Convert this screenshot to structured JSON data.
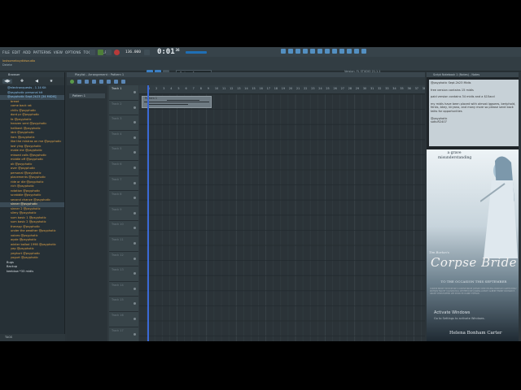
{
  "menu": [
    "FILE",
    "EDIT",
    "ADD",
    "PATTERNS",
    "VIEW",
    "OPTIONS",
    "TOOLS",
    "HELP"
  ],
  "transport": {
    "tempo": "136.000",
    "time": "0:01",
    "time_sub": "36"
  },
  "hint": {
    "line1": "lostsomeboydidsaudio",
    "line2": "Delete"
  },
  "toolbar": {
    "pattern": "Pattern 1"
  },
  "news": {
    "title": "Version: FL STUDIO 21.1.1",
    "link": "What's New?"
  },
  "browser": {
    "title": "Browser",
    "tabs": [
      "◀▶",
      "✚",
      "◀",
      "★"
    ],
    "items": [
      {
        "label": "@electronquests - 1.14 Kit",
        "kind": "folder top"
      },
      {
        "label": "@psyphotic personal kit",
        "kind": "folder top"
      },
      {
        "label": "@psyphotic Sept.2k23 [34 MIDIS]",
        "kind": "folder top cur"
      },
      {
        "label": "bread",
        "kind": "file"
      },
      {
        "label": "come back rat",
        "kind": "file"
      },
      {
        "label": "chills @psyphotic",
        "kind": "file"
      },
      {
        "label": "dont pr @psyphotic",
        "kind": "file"
      },
      {
        "label": "fa @psyphotic",
        "kind": "file"
      },
      {
        "label": "heaven sent @psyphotic",
        "kind": "file"
      },
      {
        "label": "hellbent @psyphotic",
        "kind": "file"
      },
      {
        "label": "idnt @psyphotic",
        "kind": "file"
      },
      {
        "label": "liars @psyphotic",
        "kind": "file"
      },
      {
        "label": "like the mistras on me @psyphotic",
        "kind": "file"
      },
      {
        "label": "lost ying @psyphotic",
        "kind": "file"
      },
      {
        "label": "make me @psyphotic",
        "kind": "file"
      },
      {
        "label": "missed calls @psyphotic",
        "kind": "file"
      },
      {
        "label": "middle off @psyphotic",
        "kind": "file"
      },
      {
        "label": "ok @psyphotic",
        "kind": "file"
      },
      {
        "label": "over @psyphotic",
        "kind": "file"
      },
      {
        "label": "personal @psyphotic",
        "kind": "file"
      },
      {
        "label": "placements @psyphotic",
        "kind": "file"
      },
      {
        "label": "ride or die @psyphotic",
        "kind": "file"
      },
      {
        "label": "rich @psyphotic",
        "kind": "file"
      },
      {
        "label": "rotation @psyphotic",
        "kind": "file"
      },
      {
        "label": "scrabble @psyphotic",
        "kind": "file"
      },
      {
        "label": "second chance @psyphotic",
        "kind": "file"
      },
      {
        "label": "sinner @psyphotic",
        "kind": "file cur"
      },
      {
        "label": "sinner 2 @psyphotic",
        "kind": "file"
      },
      {
        "label": "slimy @psyphotic",
        "kind": "file"
      },
      {
        "label": "sum basic 1 @psyphotic",
        "kind": "file"
      },
      {
        "label": "sum basic 2 @psyphotic",
        "kind": "file"
      },
      {
        "label": "therapy @psyphotic",
        "kind": "file"
      },
      {
        "label": "under the weather @psyphotic",
        "kind": "file"
      },
      {
        "label": "voices @psyphotic",
        "kind": "file"
      },
      {
        "label": "wyde @psyphotic",
        "kind": "file"
      },
      {
        "label": "winter ballad 1998 @psyphotic",
        "kind": "file"
      },
      {
        "label": "yep @psyphotic",
        "kind": "file"
      },
      {
        "label": "yeghurt @psyphotic",
        "kind": "file"
      },
      {
        "label": "yogurt @psyphotic",
        "kind": "file"
      },
      {
        "label": "Bugs",
        "kind": "white"
      },
      {
        "label": "Backup",
        "kind": "white"
      },
      {
        "label": "keeblow *33 midis",
        "kind": "white"
      }
    ],
    "footer": "TAGS"
  },
  "playlist": {
    "title": "Playlist - Arrangement › Pattern 1",
    "pattern_chip": "Pattern 1",
    "tracks": [
      "Track 1",
      "Track 2",
      "Track 3",
      "Track 4",
      "Track 5",
      "Track 6",
      "Track 7",
      "Track 8",
      "Track 9",
      "Track 10",
      "Track 11",
      "Track 12",
      "Track 13",
      "Track 14",
      "Track 15",
      "Track 16",
      "Track 17"
    ],
    "ruler": [
      "1",
      "2",
      "3",
      "4",
      "5",
      "6",
      "7",
      "8",
      "9",
      "10",
      "11",
      "12",
      "13",
      "14",
      "15",
      "16",
      "17",
      "18",
      "19",
      "20",
      "21",
      "22",
      "23",
      "24",
      "25",
      "26",
      "27",
      "28",
      "29",
      "30",
      "31",
      "32",
      "33",
      "34",
      "35",
      "36",
      "37",
      "38"
    ],
    "clip": "Pattern 1"
  },
  "notes": {
    "title": "Script Notebook 1 (Notes) - Notes",
    "p1": "@psyphotic Sept.2k23 Midis",
    "p2": "free version contains 15 midis",
    "p3": "paid version contains 34 midis and a $15acd",
    "p4": "my midis have been placed with almost iggsees, beriphold, fenks, bkey, kiryano, and many more so please send back talks for opportunities",
    "p5": "@psyphotic",
    "p6": "sotiuR2407"
  },
  "poster": {
    "tag": "a grave misunderstanding",
    "director": "Tim Burton's",
    "title": "Corpse Bride",
    "tagline": "TO THE OCCASION THIS SEPTEMBER",
    "credits": "CORPSE BRIDE TIM BURTON'S CORPSE BRIDE JOHNNY DEPP HELENA BONHAM CARTER EMILY WATSON TRACEY ULLMAN PAUL WHITEHOUSE JOANNA LUMLEY ALBERT FINNEY RICHARD E. GRANT CHRISTOPHER LEE MUSIC BY DANNY ELFMAN",
    "activate": "Activate Windows",
    "activate_sub": "Go to Settings to activate Windows.",
    "actor": "Helena Bonham Carter"
  }
}
